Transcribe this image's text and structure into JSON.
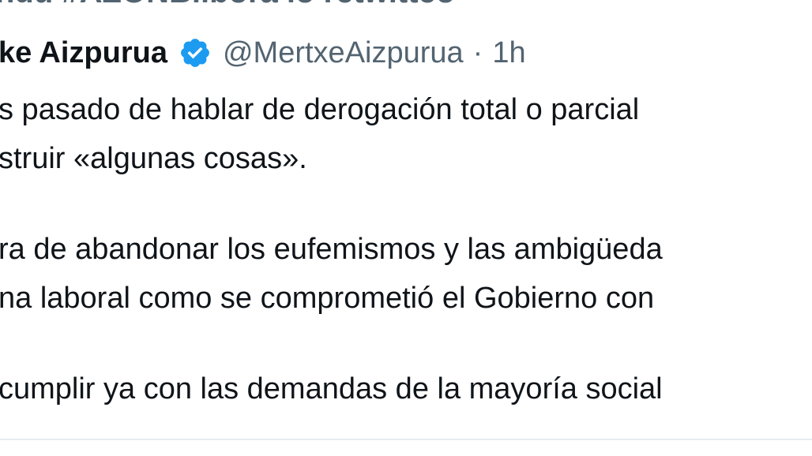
{
  "retweet_context": "ndu #AZONBilbora lo retwitteó",
  "author": {
    "display_name": "ke Aizpurua",
    "handle": "@MertxeAizpurua",
    "separator": "·",
    "time": "1h",
    "verified_icon": "verified-badge-icon"
  },
  "tweet": {
    "lines": [
      "s pasado de hablar de derogación total o parcial",
      "struir «algunas cosas».",
      "",
      "ra de abandonar los eufemismos y las ambigüeda",
      "na laboral como se comprometió el Gobierno con",
      "",
      "cumplir ya con las demandas de la mayoría social"
    ]
  },
  "colors": {
    "text": "#0f1419",
    "secondary": "#536471",
    "verified": "#1d9bf0",
    "divider": "#e6ecf0"
  }
}
